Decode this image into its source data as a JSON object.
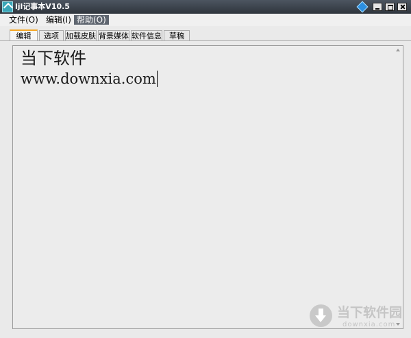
{
  "window": {
    "title": "ljl记事本V10.5"
  },
  "menu": {
    "file": "文件(O)",
    "edit": "编辑(I)",
    "help": "帮助(O)"
  },
  "tabs": [
    "编辑",
    "选项",
    "加载皮肤",
    "背景媒体",
    "软件信息",
    "草稿"
  ],
  "editor": {
    "line1": "当下软件",
    "line2": "www.downxia.com"
  },
  "watermark": {
    "name": "当下软件园",
    "url": "downxia.com"
  },
  "colors": {
    "active_tab_accent": "#f5a623",
    "titlebar": "#3c434c",
    "help_menu_highlight": "#5f6670"
  }
}
